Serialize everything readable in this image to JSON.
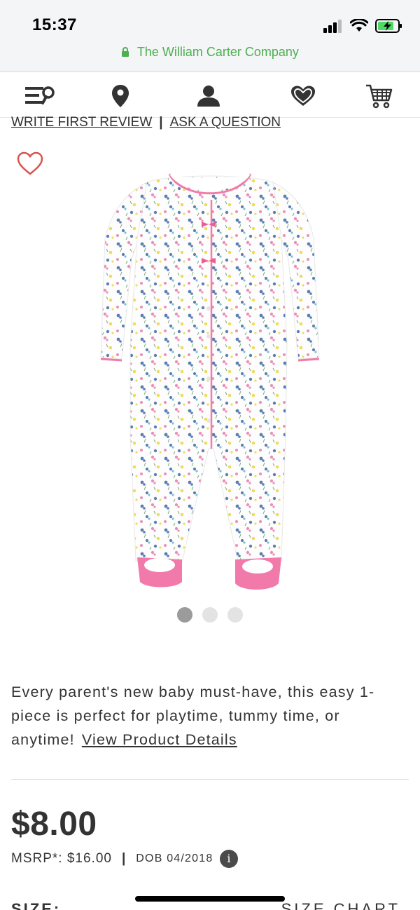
{
  "status_bar": {
    "time": "15:37",
    "icons": [
      "signal-icon",
      "wifi-icon",
      "battery-charging-icon"
    ]
  },
  "browser": {
    "site_name": "The William Carter Company",
    "secure_color": "#4caf50"
  },
  "nav": {
    "items": [
      {
        "name": "menu-search-icon"
      },
      {
        "name": "store-locator-icon"
      },
      {
        "name": "account-icon"
      },
      {
        "name": "wishlist-icon"
      },
      {
        "name": "cart-icon"
      }
    ]
  },
  "reviews": {
    "write_review": "WRITE FIRST REVIEW",
    "separator": "|",
    "ask_question": "ASK A QUESTION"
  },
  "product": {
    "image_icon": "floral-footed-sleeper-image",
    "carousel": {
      "count": 3,
      "active": 0
    },
    "description": "Every parent's new baby must-have, this easy 1-piece is perfect for playtime, tummy time, or anytime!",
    "details_link": "View Product Details",
    "price": "$8.00",
    "msrp": "MSRP*: $16.00",
    "pipe": "|",
    "dob": "DOB 04/2018",
    "info_icon": "i",
    "size_label": "SIZE:",
    "size_chart": "SIZE CHART"
  },
  "colors": {
    "accent_pink": "#e75a88",
    "heart_outline": "#d9534f",
    "text": "#333333"
  }
}
